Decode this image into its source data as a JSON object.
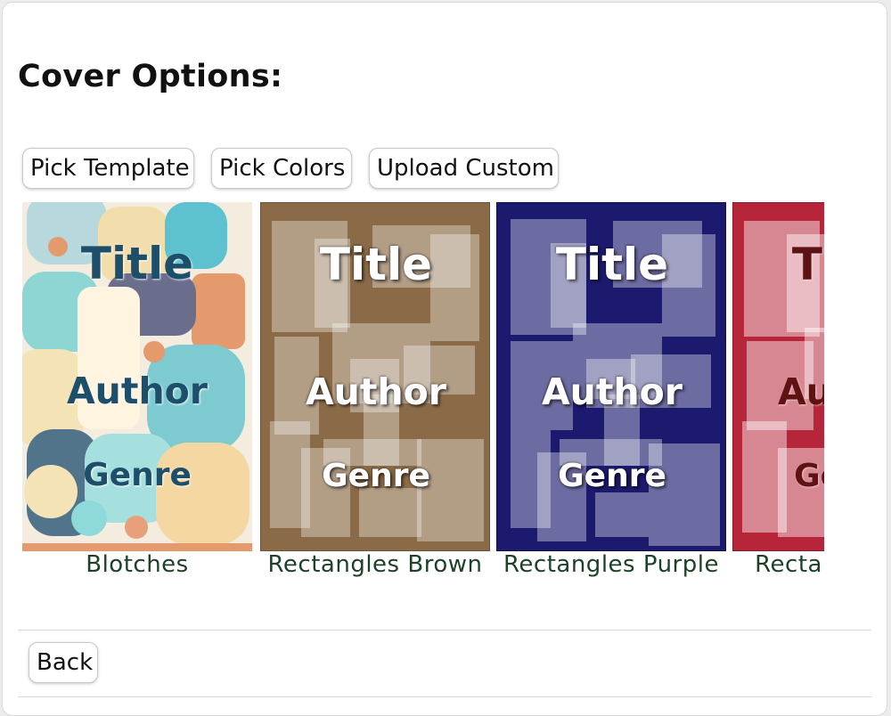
{
  "heading": "Cover Options:",
  "buttons": {
    "pick_template": "Pick Template",
    "pick_colors": "Pick Colors",
    "upload_custom": "Upload Custom",
    "back": "Back"
  },
  "covers": [
    {
      "label": "Blotches",
      "title": "Title",
      "author": "Author",
      "genre": "Genre",
      "style": "blotches",
      "colors": {
        "text": "#1d4f6b",
        "accent": "#7cd0d6"
      }
    },
    {
      "label": "Rectangles Brown",
      "title": "Title",
      "author": "Author",
      "genre": "Genre",
      "style": "rectangles",
      "colors": {
        "base": "#8b6b47",
        "text": "#ffffff"
      }
    },
    {
      "label": "Rectangles Purple",
      "title": "Title",
      "author": "Author",
      "genre": "Genre",
      "style": "rectangles",
      "colors": {
        "base": "#1c1a6e",
        "text": "#ffffff"
      }
    },
    {
      "label": "Rectangles Red",
      "title": "Title",
      "author": "Author",
      "genre": "Genre",
      "style": "rectangles",
      "colors": {
        "base": "#b6253a",
        "text": "#5e1212"
      }
    }
  ],
  "colors": {
    "label_text": "#1e4227",
    "heading_text": "#111111"
  }
}
